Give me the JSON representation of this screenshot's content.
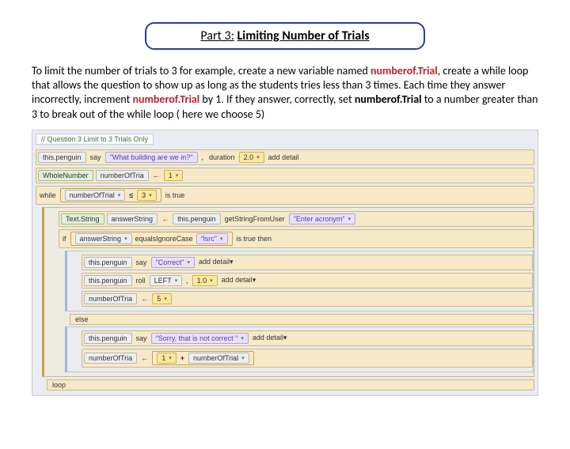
{
  "title": {
    "prefix": "Part 3:",
    "main": "Limiting Number of Trials"
  },
  "paragraph": {
    "t1": "To limit the number of trials to 3 for example, create a new variable named ",
    "kw1": "numberof.Trial",
    "t2": ", create a while loop that allows the question to show up as long as the students tries less than 3 times. Each time they answer incorrectly, increment ",
    "kw2": "numberof.Trial",
    "t3": " by 1. If they answer, correctly, set ",
    "kw3": "numberof.Trial",
    "t4": " to a number greater than 3 to break out of the while loop ( here we choose 5)"
  },
  "code": {
    "comment": "// Question 3 Limit to 3 Trials Only",
    "line1": {
      "obj": "this.penguin",
      "say": "say",
      "q": "\"What building are we in?\"",
      "comma": ",",
      "dur": "duration",
      "durv": "2.0",
      "add": "add detail"
    },
    "line2": {
      "type": "WholeNumber",
      "var": "numberOfTria",
      "assign": "←",
      "val": "1"
    },
    "while": {
      "kw": "while",
      "var": "numberOfTrial",
      "op": "≤",
      "val": "3",
      "tail": "is true"
    },
    "line3": {
      "type": "Text.String",
      "var": "answerString",
      "assign": "←",
      "obj": "this.penguin",
      "fn": "getStringFromUser",
      "arg": "\"Enter acronym\""
    },
    "ifline": {
      "kw": "if",
      "var": "answerString",
      "fn": "equalsIgnoreCase",
      "arg": "\"lsrc\"",
      "tail": "is true then"
    },
    "line4": {
      "obj": "this.penguin",
      "say": "say",
      "arg": "\"Correct\"",
      "add": "add detail"
    },
    "line5": {
      "obj": "this.penguin",
      "roll": "roll",
      "dir": "LEFT",
      "comma": ",",
      "amt": "1.0",
      "add": "add detail"
    },
    "line6": {
      "var": "numberOfTria",
      "assign": "←",
      "val": "5"
    },
    "else": "else",
    "line7": {
      "obj": "this.penguin",
      "say": "say",
      "arg": "\"Sorry, that is not correct \"",
      "add": "add detail"
    },
    "line8": {
      "var": "numberOfTria",
      "assign": "←",
      "v1": "1",
      "op": "+",
      "v2": "numberOfTrial"
    },
    "loop": "loop"
  }
}
